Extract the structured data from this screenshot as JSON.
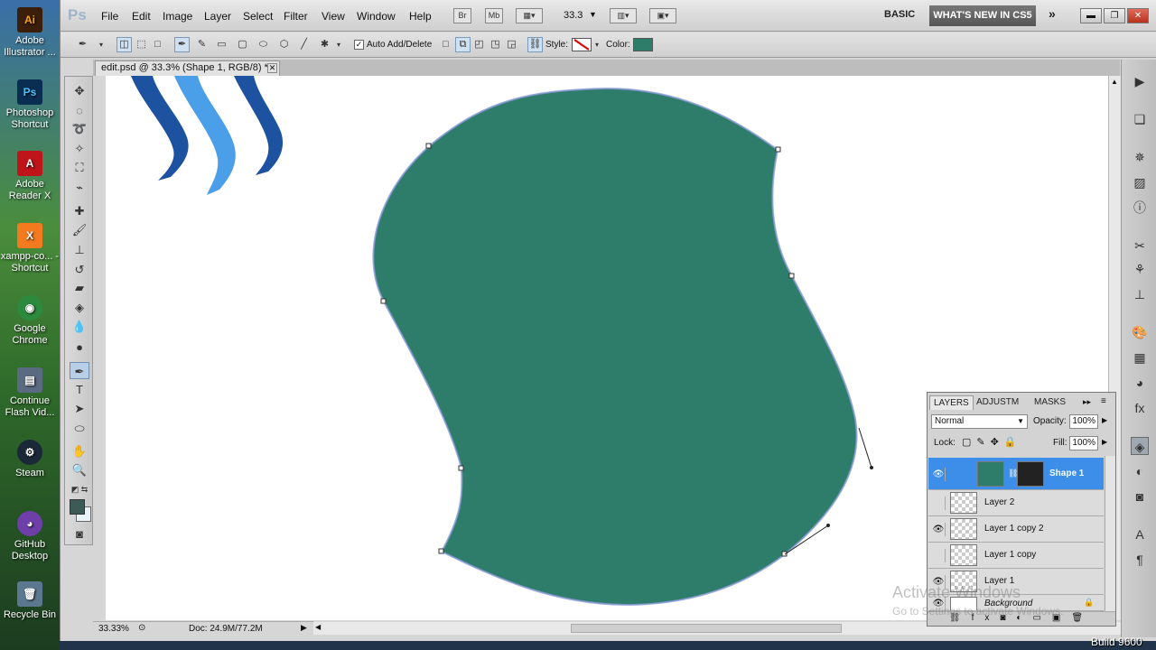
{
  "desktop": {
    "icons": [
      {
        "label": "Adobe Illustrator ...",
        "glyph": "Ai",
        "color": "#3b1f0a"
      },
      {
        "label": "Photoshop Shortcut",
        "glyph": "Ps",
        "color": "#0a2d52"
      },
      {
        "label": "Adobe Reader X",
        "glyph": "A",
        "color": "#c0141b"
      },
      {
        "label": "xampp-co... - Shortcut",
        "glyph": "X",
        "color": "#f37a1f"
      },
      {
        "label": "Google Chrome",
        "glyph": "◉",
        "color": "#2b8a3e"
      },
      {
        "label": "Continue Flash Vid...",
        "glyph": "▤",
        "color": "#5a6a80"
      },
      {
        "label": "Steam",
        "glyph": "⚙",
        "color": "#1b2838"
      },
      {
        "label": "GitHub Desktop",
        "glyph": "◕",
        "color": "#6e3fa8"
      },
      {
        "label": "Recycle Bin",
        "glyph": "🗑",
        "color": "#5c7890"
      }
    ]
  },
  "app": {
    "logo": "Ps",
    "menu": [
      "File",
      "Edit",
      "Image",
      "Layer",
      "Select",
      "Filter",
      "View",
      "Window",
      "Help"
    ],
    "bridge": "Br",
    "minibridge": "Mb",
    "zoom": "33.3",
    "workspace": "BASIC",
    "whats_new": "WHAT'S NEW IN CS5",
    "more": "»"
  },
  "options": {
    "auto_add_delete": "Auto Add/Delete",
    "auto_add_delete_checked": true,
    "style_label": "Style:",
    "color_label": "Color:",
    "color": "#2e7d6a"
  },
  "document": {
    "tab_title": "edit.psd @ 33.3% (Shape 1, RGB/8) *",
    "zoom": "33.33%",
    "doc_size": "Doc: 24.9M/77.2M"
  },
  "layers_panel": {
    "tabs": [
      "LAYERS",
      "ADJUSTM",
      "MASKS"
    ],
    "blend_mode": "Normal",
    "opacity_label": "Opacity:",
    "opacity": "100%",
    "lock_label": "Lock:",
    "fill_label": "Fill:",
    "fill": "100%",
    "layers": [
      {
        "name": "Shape 1",
        "visible": true,
        "selected": true
      },
      {
        "name": "Layer 2",
        "visible": false,
        "selected": false
      },
      {
        "name": "Layer 1 copy 2",
        "visible": true,
        "selected": false
      },
      {
        "name": "Layer 1 copy",
        "visible": false,
        "selected": false
      },
      {
        "name": "Layer 1",
        "visible": true,
        "selected": false
      },
      {
        "name": "Background",
        "visible": true,
        "selected": false
      }
    ]
  },
  "watermark": {
    "line1": "Activate Windows",
    "line2": "Go to Settings to activate Windows."
  },
  "system": {
    "build": "Build 9600"
  },
  "shape": {
    "fill": "#2e7d6a",
    "logo_dark": "#1c52a0",
    "logo_light": "#4a9fe8"
  }
}
